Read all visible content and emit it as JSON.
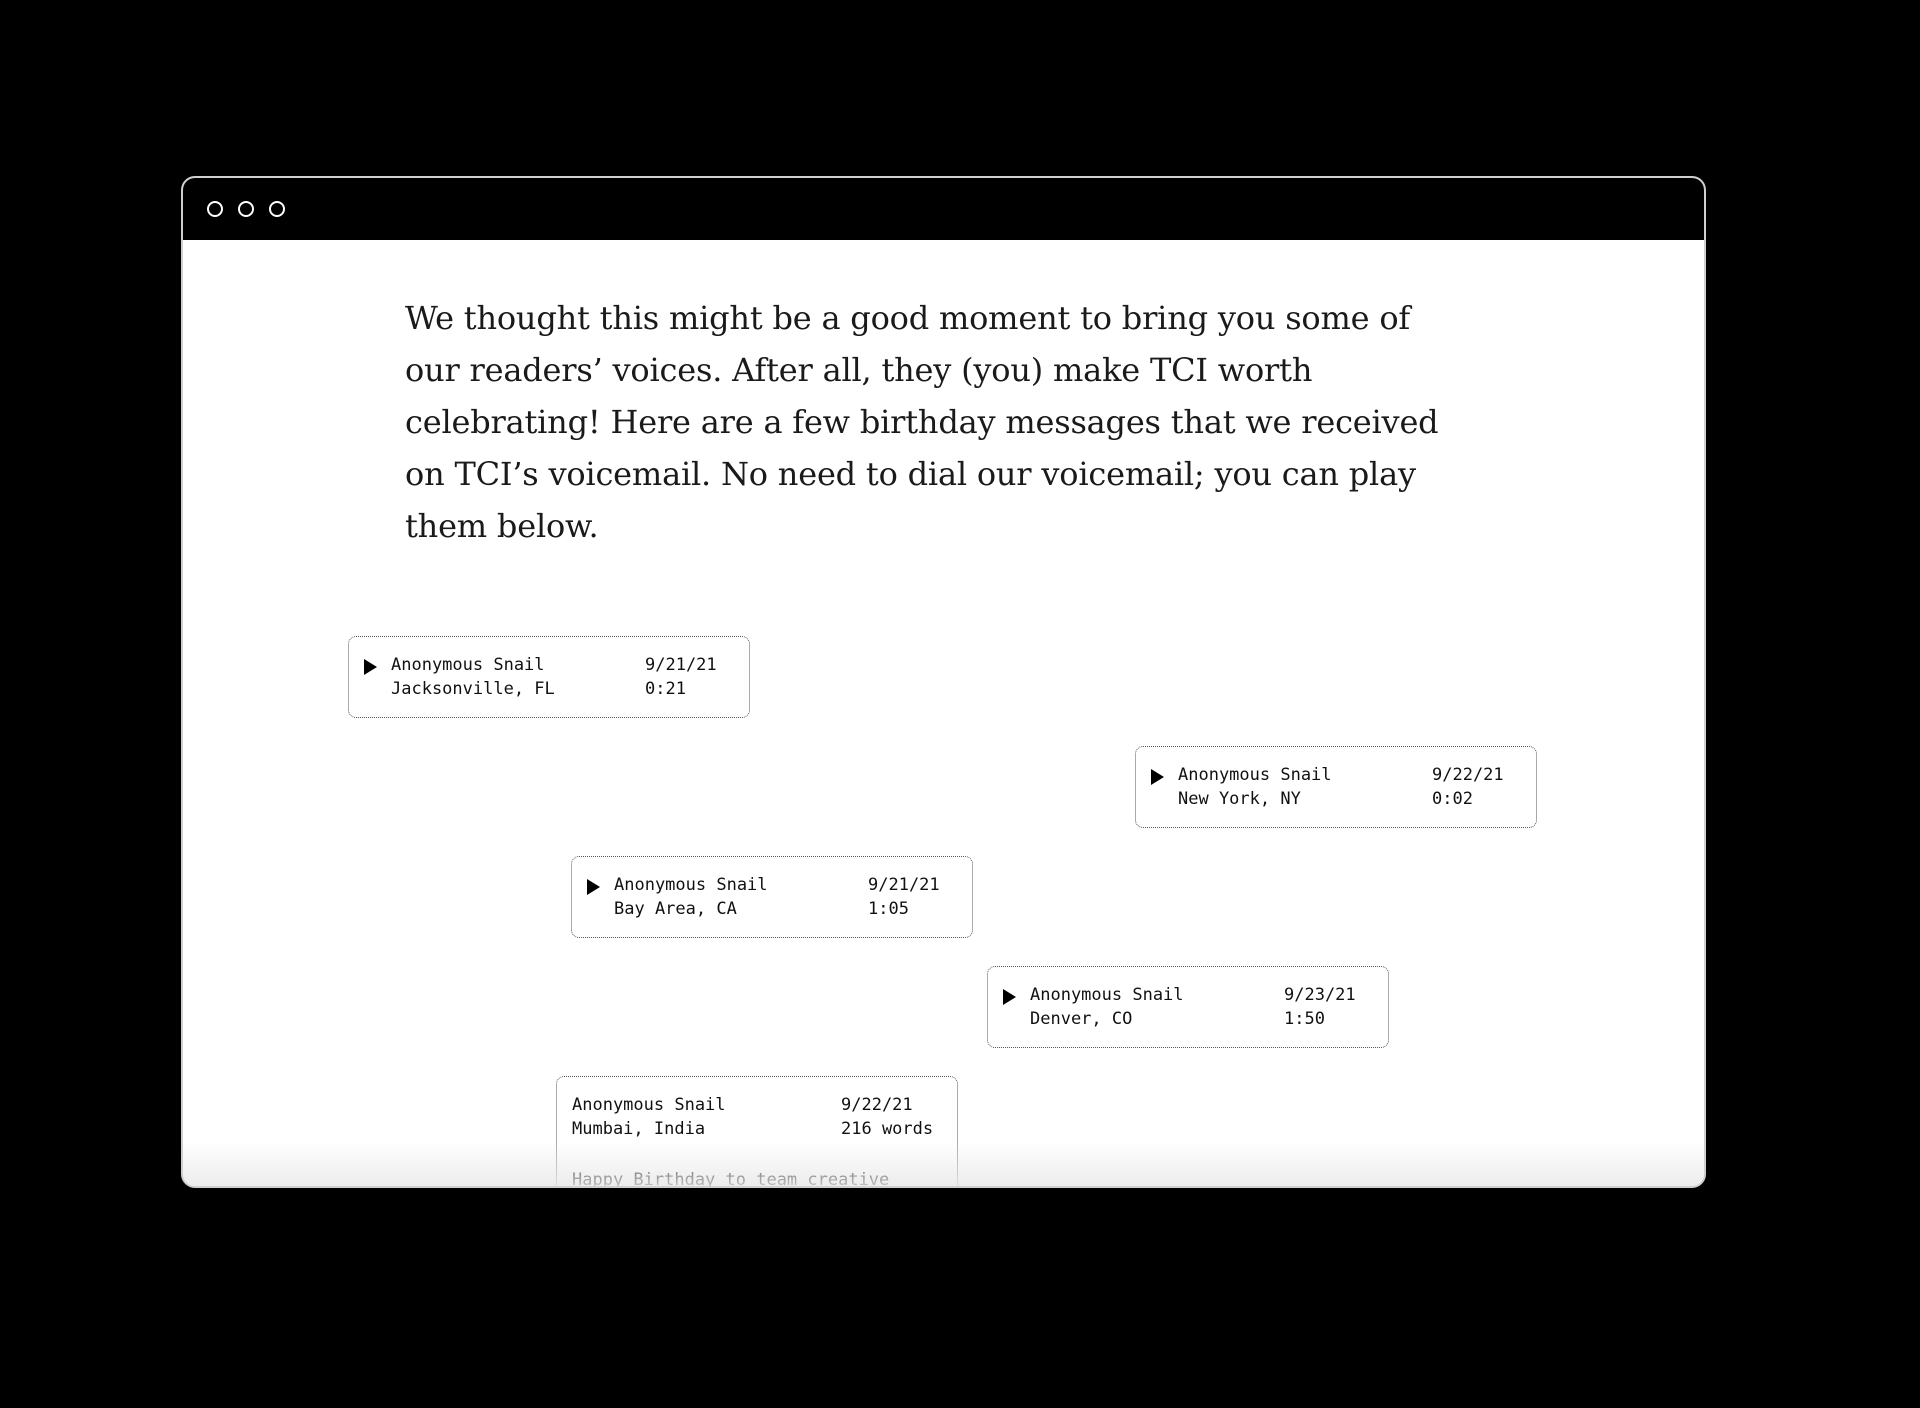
{
  "intro": {
    "text": "We thought this might be a good moment to bring you some of our readers’ voices. After all, they (you) make TCI worth celebrating! Here are a few birthday messages that we received on TCI’s voicemail. No need to dial our voicemail; you can play them below."
  },
  "messages": [
    {
      "name": "Anonymous Snail",
      "location": "Jacksonville, FL",
      "date": "9/21/21",
      "duration": "0:21",
      "play_icon": "play-icon"
    },
    {
      "name": "Anonymous Snail",
      "location": "New York, NY",
      "date": "9/22/21",
      "duration": "0:02",
      "play_icon": "play-icon"
    },
    {
      "name": "Anonymous Snail",
      "location": "Bay Area, CA",
      "date": "9/21/21",
      "duration": "1:05",
      "play_icon": "play-icon"
    },
    {
      "name": "Anonymous Snail",
      "location": "Denver, CO",
      "date": "9/23/21",
      "duration": "1:50",
      "play_icon": "play-icon"
    }
  ],
  "text_message": {
    "name": "Anonymous Snail",
    "location": "Mumbai, India",
    "date": "9/22/21",
    "length": "216 words",
    "body": "Happy Birthday to team creative"
  },
  "colors": {
    "frame": "#000000",
    "page": "#ffffff",
    "text": "#111111",
    "card_border": "#555555"
  }
}
